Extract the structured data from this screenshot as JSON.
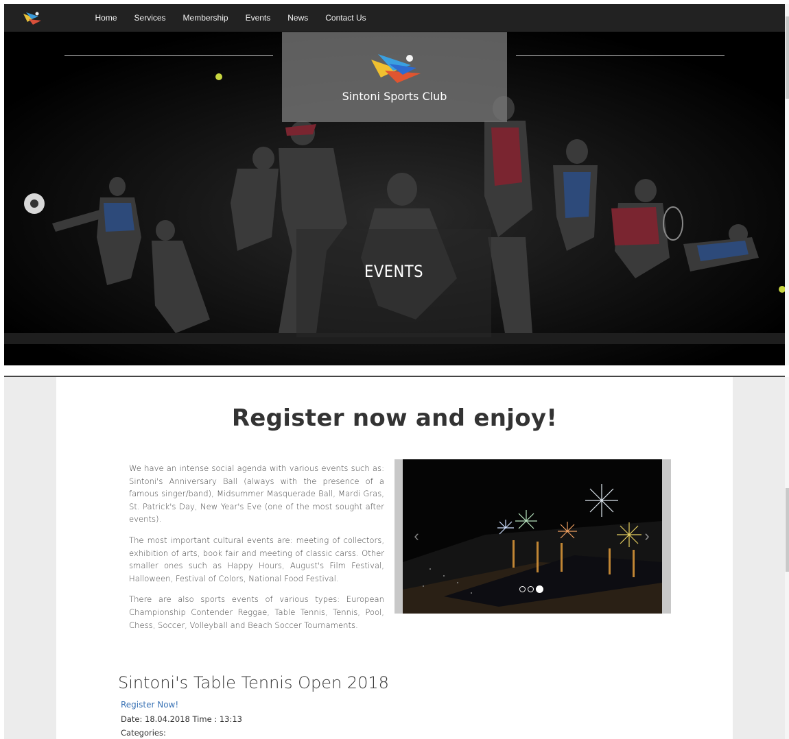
{
  "nav": {
    "logo_icon": "sintoni-swimmer-logo-icon",
    "items": [
      {
        "label": "Home"
      },
      {
        "label": "Services"
      },
      {
        "label": "Membership"
      },
      {
        "label": "Events"
      },
      {
        "label": "News"
      },
      {
        "label": "Contact Us"
      }
    ]
  },
  "hero": {
    "brand_name": "Sintoni Sports Club",
    "section_title": "EVENTS"
  },
  "main": {
    "heading": "Register now and enjoy!",
    "paragraphs": [
      "We have an intense social agenda with various events such as: Sintoni's Anniversary Ball (always with the presence of a famous singer/band), Midsummer Masquerade Ball, Mardi Gras, St. Patrick's Day, New Year's Eve (one of the most sought after events).",
      "The most important cultural events are: meeting of collectors, exhibition of arts, book fair and meeting of classic carss. Other smaller ones such as Happy Hours, August's Film Festival, Halloween, Festival of Colors, National Food Festival.",
      "There are also sports events of various types: European Championship Contender Reggae, Table Tennis, Tennis, Pool, Chess, Soccer, Volleyball and Beach Soccer Tournaments."
    ],
    "carousel": {
      "prev_label": "‹",
      "next_label": "›",
      "slides": 3,
      "active_slide": 3
    }
  },
  "event": {
    "title": "Sintoni's Table Tennis Open 2018",
    "register_label": "Register Now!",
    "date_line": "Date: 18.04.2018 Time : 13:13",
    "categories_label": "Categories:"
  },
  "colors": {
    "nav_bg": "#222222",
    "link_blue": "#3a73b5",
    "heading_text": "#333333",
    "page_side_bg": "#ececec"
  }
}
